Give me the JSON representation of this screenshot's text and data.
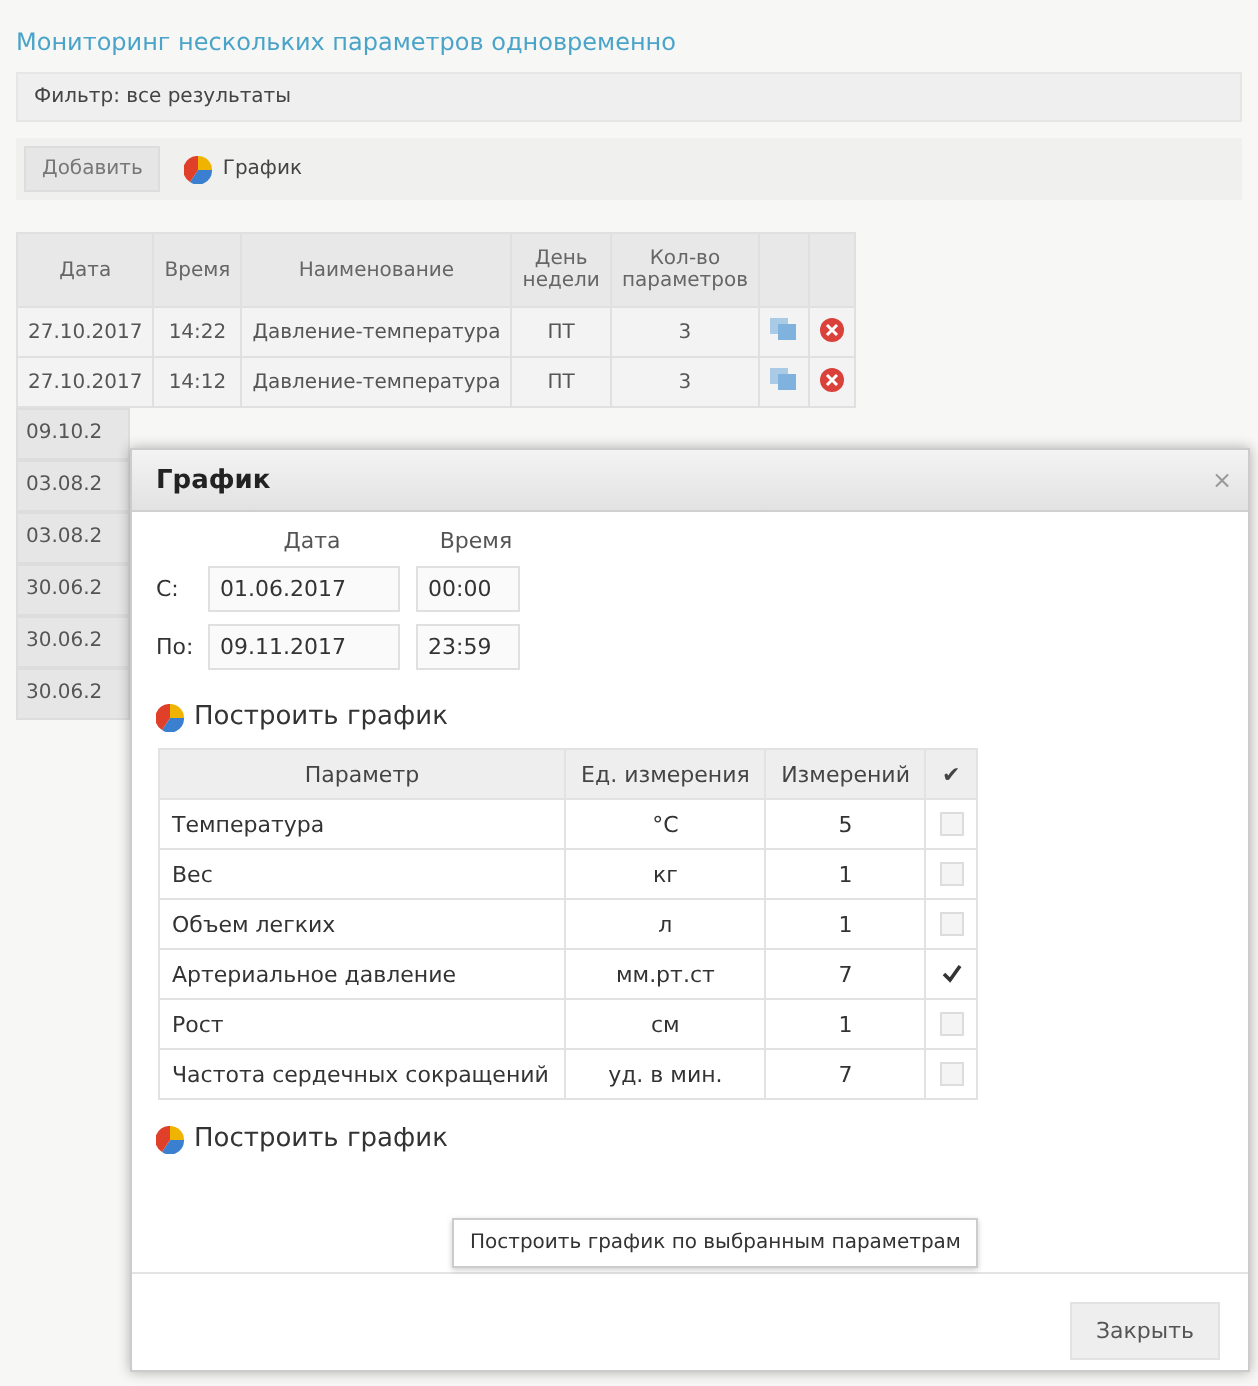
{
  "page_title": "Мониторинг нескольких параметров одновременно",
  "filter": {
    "label": "Фильтр: все результаты"
  },
  "toolbar": {
    "add_button": "Добавить",
    "chart_link": "График"
  },
  "table": {
    "columns": [
      "Дата",
      "Время",
      "Наименование",
      "День недели",
      "Кол-во параметров"
    ],
    "rows": [
      {
        "cells": [
          "27.10.2017",
          "14:22",
          "Давление-температура",
          "ПТ",
          "3"
        ]
      },
      {
        "cells": [
          "27.10.2017",
          "14:12",
          "Давление-температура",
          "ПТ",
          "3"
        ]
      }
    ],
    "partly_hidden_rows": [
      "09.10.2",
      "03.08.2",
      "03.08.2",
      "30.06.2",
      "30.06.2",
      "30.06.2"
    ]
  },
  "dialog": {
    "title": "График",
    "close": "×",
    "period": {
      "columns": [
        "Дата",
        "Время"
      ],
      "rows": [
        {
          "label": "С:",
          "date": "01.06.2017",
          "time": "00:00"
        },
        {
          "label": "По:",
          "date": "09.11.2017",
          "time": "23:59"
        }
      ]
    },
    "build_link_top": "Построить график",
    "parameters": {
      "columns": [
        "Параметр",
        "Ед. измерения",
        "Измерений",
        "✔"
      ],
      "rows": [
        {
          "name": "Температура",
          "unit": "°C",
          "count": "5",
          "checked": false
        },
        {
          "name": "Вес",
          "unit": "кг",
          "count": "1",
          "checked": false
        },
        {
          "name": "Объем легких",
          "unit": "л",
          "count": "1",
          "checked": false
        },
        {
          "name": "Артериальное давление",
          "unit": "мм.рт.ст",
          "count": "7",
          "checked": true
        },
        {
          "name": "Рост",
          "unit": "см",
          "count": "1",
          "checked": false
        },
        {
          "name": "Частота сердечных сокращений",
          "unit": "уд. в мин.",
          "count": "7",
          "checked": false
        }
      ]
    },
    "build_link_bottom": "Построить график",
    "tooltip": "Построить график по выбранным параметрам",
    "close_button": "Закрыть"
  }
}
